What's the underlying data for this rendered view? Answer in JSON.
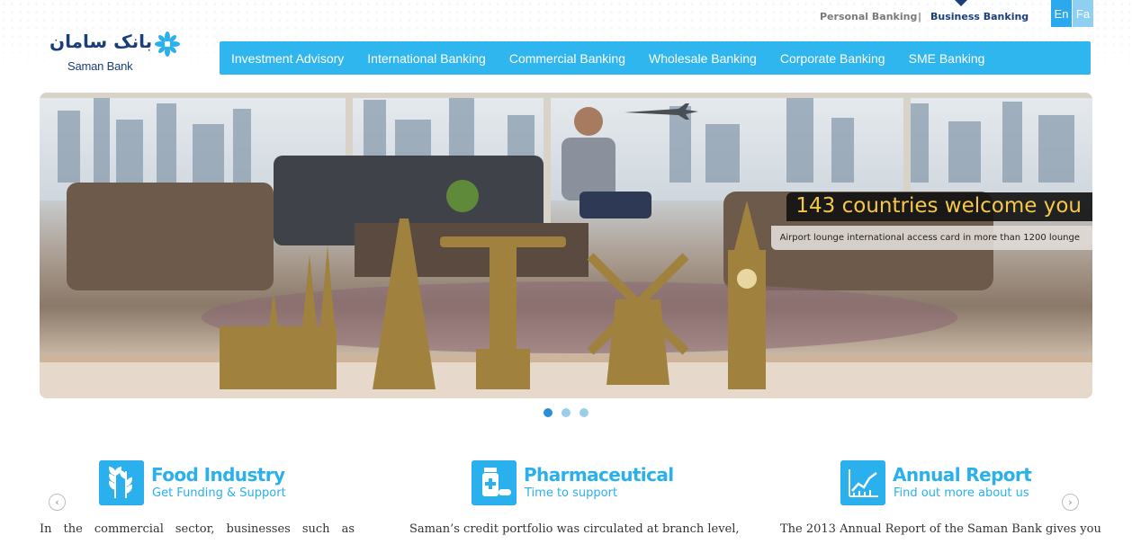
{
  "header": {
    "logo_fa": "بانک سامان",
    "logo_en": "Saman Bank",
    "top_links": {
      "personal": "Personal Banking",
      "separator": "|",
      "business": "Business Banking"
    },
    "languages": [
      "En",
      "Fa"
    ]
  },
  "nav": {
    "items": [
      {
        "label": "Investment Advisory"
      },
      {
        "label": "International Banking"
      },
      {
        "label": "Commercial Banking"
      },
      {
        "label": "Wholesale Banking"
      },
      {
        "label": "Corporate Banking"
      },
      {
        "label": "SME Banking"
      }
    ]
  },
  "hero": {
    "caption": "143 countries welcome you",
    "subcaption": "Airport lounge international access card in more than 1200 lounge",
    "slides": 3,
    "active_slide": 1
  },
  "features": [
    {
      "title": "Food Industry",
      "subtitle": "Get Funding & Support",
      "icon": "wheat-icon",
      "text": "In the commercial sector, businesses such as"
    },
    {
      "title": "Pharmaceutical",
      "subtitle": "Time to support",
      "icon": "medicine-icon",
      "text": "Saman’s credit portfolio was circulated at branch level,"
    },
    {
      "title": "Annual Report",
      "subtitle": "Find out more about us",
      "icon": "chart-icon",
      "text": "The 2013 Annual Report of the Saman Bank gives you"
    }
  ],
  "arrows": {
    "prev": "‹",
    "next": "›"
  },
  "colors": {
    "brand_blue": "#2fb6ef",
    "navy": "#1a3e7a",
    "caption_gold": "#f5c84a"
  }
}
